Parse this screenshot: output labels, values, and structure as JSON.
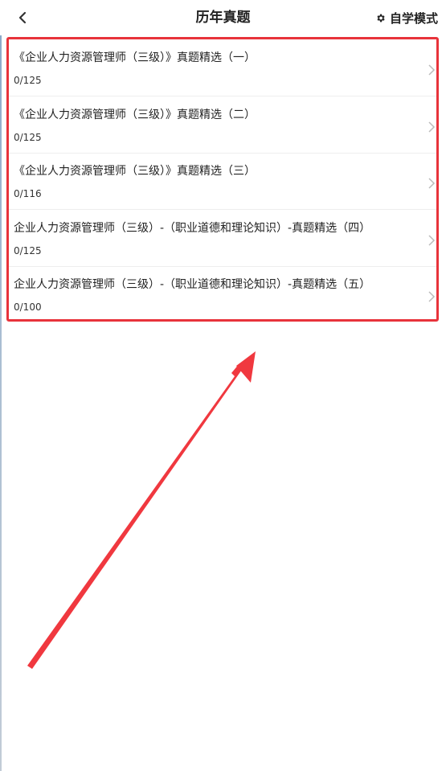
{
  "header": {
    "title": "历年真题",
    "mode_label": "自学模式",
    "back_icon": "chevron-left-icon",
    "mode_icon": "gear-icon"
  },
  "exam_list": [
    {
      "title": "《企业人力资源管理师（三级）》真题精选（一）",
      "progress": "0/125"
    },
    {
      "title": "《企业人力资源管理师（三级）》真题精选（二）",
      "progress": "0/125"
    },
    {
      "title": "《企业人力资源管理师（三级）》真题精选（三）",
      "progress": "0/116"
    },
    {
      "title": "企业人力资源管理师（三级）-（职业道德和理论知识）-真题精选（四）",
      "progress": "0/125"
    },
    {
      "title": "企业人力资源管理师（三级）-（职业道德和理论知识）-真题精选（五）",
      "progress": "0/100"
    }
  ],
  "colors": {
    "highlight": "#e8333b",
    "text": "#222222",
    "chevron": "#bbbbbb"
  }
}
